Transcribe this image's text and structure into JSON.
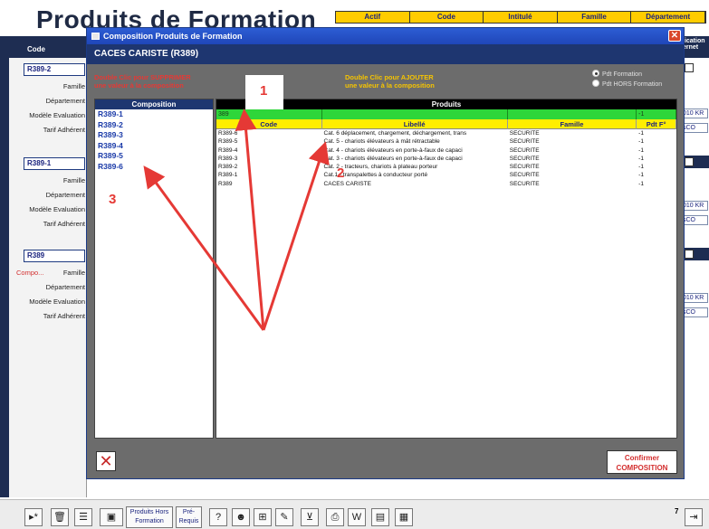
{
  "background": {
    "title": "Produits de Formation",
    "header_columns": [
      "Actif",
      "Code",
      "Intitulé",
      "Famille",
      "Département"
    ],
    "code_col_header": "Code",
    "right_col_header": "lication ernet",
    "records": [
      {
        "code": "R389-2",
        "rows": [
          "Famille",
          "Département",
          "Modèle Evaluation",
          "Tarif Adhérent"
        ]
      },
      {
        "code": "R389-1",
        "rows": [
          "Famille",
          "Département",
          "Modèle Evaluation",
          "Tarif Adhérent"
        ]
      },
      {
        "code": "R389",
        "compo_label": "Compo...",
        "rows": [
          "Famille",
          "Département",
          "Modèle Evaluation",
          "Tarif Adhérent"
        ]
      }
    ],
    "combo_value": "sCO",
    "field_value": "010 KR"
  },
  "modal": {
    "window_title": "Composition Produits de Formation",
    "header": "CACES CARISTE (R389)",
    "instr_delete": [
      "Double Clic pour SUPPRIMER",
      "une valeur à la composition"
    ],
    "instr_add": [
      "Double Clic pour AJOUTER",
      "une valeur à la composition"
    ],
    "radios": [
      {
        "label": "Pdt Formation",
        "checked": true
      },
      {
        "label": "Pdt HORS Formation",
        "checked": false
      }
    ],
    "composition_header": "Composition",
    "composition_items": [
      "R389-1",
      "R389-2",
      "R389-3",
      "R389-4",
      "R389-5",
      "R389-6"
    ],
    "products_header": "Produits",
    "filter": {
      "code": "389",
      "pdf": "-1"
    },
    "columns": [
      "Code",
      "Libellé",
      "Famille",
      "Pdt F°"
    ],
    "rows": [
      {
        "code": "R389-6",
        "libelle": "Cat. 6 déplacement, chargement, déchargement, trans",
        "famille": "SECURITE",
        "pdf": "-1"
      },
      {
        "code": "R389-5",
        "libelle": "Cat. 5 - chariots élévateurs à mât rétractable",
        "famille": "SECURITE",
        "pdf": "-1"
      },
      {
        "code": "R389-4",
        "libelle": "Cat. 4 - chariots élévateurs en porte-à-faux de capaci",
        "famille": "SECURITE",
        "pdf": "-1"
      },
      {
        "code": "R389-3",
        "libelle": "Cat. 3 - chariots élévateurs en porte-à-faux de capaci",
        "famille": "SECURITE",
        "pdf": "-1"
      },
      {
        "code": "R389-2",
        "libelle": "Cat. 2 - tracteurs, chariots à plateau porteur",
        "famille": "SECURITE",
        "pdf": "-1"
      },
      {
        "code": "R389-1",
        "libelle": "Cat.1 - transpalettes à conducteur porté",
        "famille": "SECURITE",
        "pdf": "-1"
      },
      {
        "code": "R389",
        "libelle": "CACES CARISTE",
        "famille": "SECURITE",
        "pdf": "-1"
      }
    ],
    "confirm_label": [
      "Confirmer",
      "COMPOSITION"
    ]
  },
  "toolbar": {
    "btn_hors_formation": [
      "Produits Hors",
      "Formation"
    ],
    "btn_prerequis": [
      "Pré-",
      "Requis"
    ],
    "page_indicator": "7"
  },
  "annotations": [
    "1",
    "2",
    "3"
  ],
  "colors": {
    "accent_red": "#e53935",
    "navy": "#1e3670",
    "green_filter": "#2ed63a",
    "yellow_header": "#ffee00"
  }
}
